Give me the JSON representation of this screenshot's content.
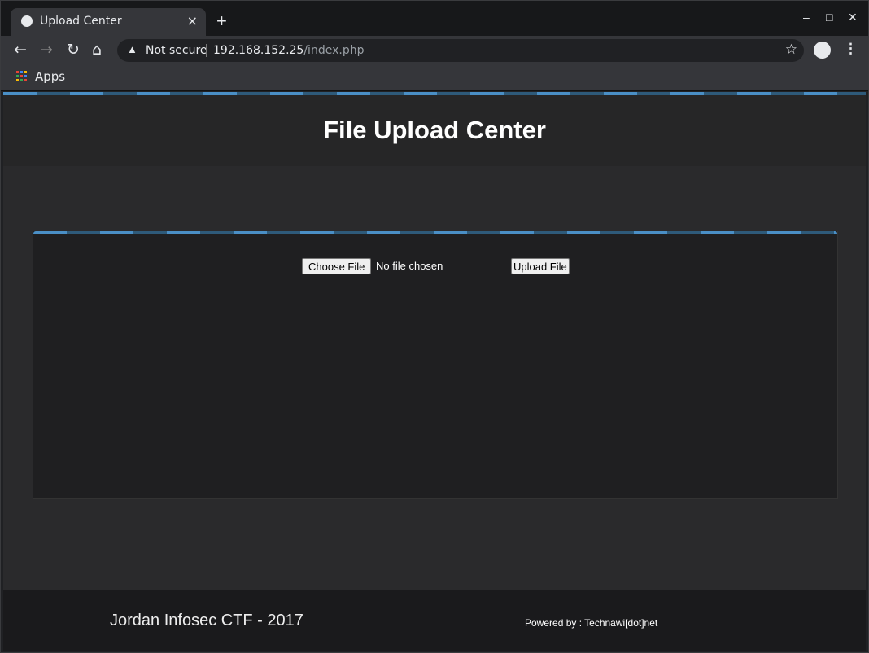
{
  "browser": {
    "tab_title": "Upload Center",
    "new_tab": "+",
    "security_label": "Not secure",
    "url_host": "192.168.152.25",
    "url_path": "/index.php",
    "bookmarks": {
      "apps_label": "Apps"
    }
  },
  "page": {
    "title": "File Upload Center",
    "choose_file_label": "Choose File",
    "no_file_text": "No file chosen",
    "upload_button_label": "Upload File",
    "footer_title": "Jordan Infosec CTF - 2017",
    "footer_powered": "Powered by : Technawi[dot]net"
  }
}
